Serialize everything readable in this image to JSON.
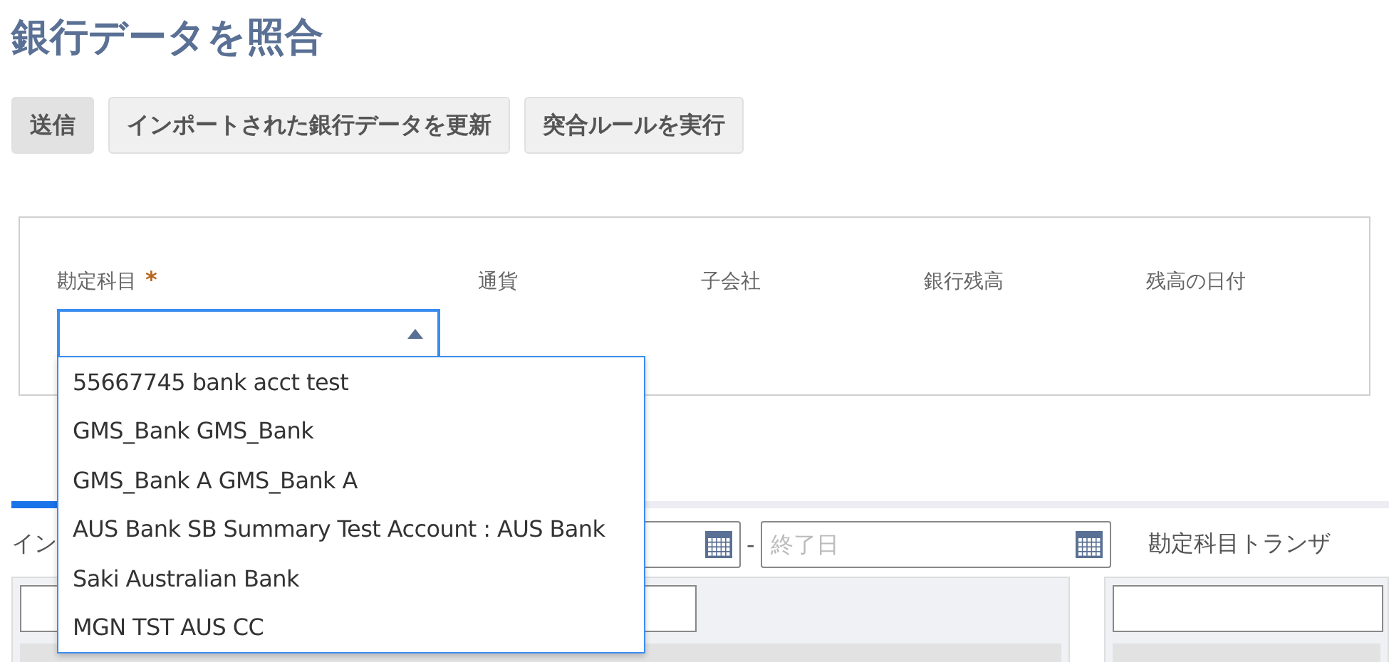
{
  "title": "銀行データを照合",
  "buttons": [
    "送信",
    "インポートされた銀行データを更新",
    "突合ルールを実行"
  ],
  "fields": [
    {
      "label": "勘定科目",
      "required": true
    },
    {
      "label": "通貨",
      "required": false
    },
    {
      "label": "子会社",
      "required": false
    },
    {
      "label": "銀行残高",
      "required": false
    },
    {
      "label": "残高の日付",
      "required": false
    }
  ],
  "required_mark": "*",
  "account_dropdown": {
    "expanded": true,
    "options": [
      "55667745 bank acct test",
      "GMS_Bank GMS_Bank",
      "GMS_Bank A GMS_Bank A",
      "AUS Bank SB Summary Test Account : AUS Bank",
      "Saki Australian Bank",
      "MGN TST AUS CC"
    ]
  },
  "tabs": [
    {
      "selected": true
    }
  ],
  "imported_label": "イン",
  "date_separator": "-",
  "end_date": {
    "placeholder": "終了日"
  },
  "account_transactions_label": "勘定科目トランザ"
}
